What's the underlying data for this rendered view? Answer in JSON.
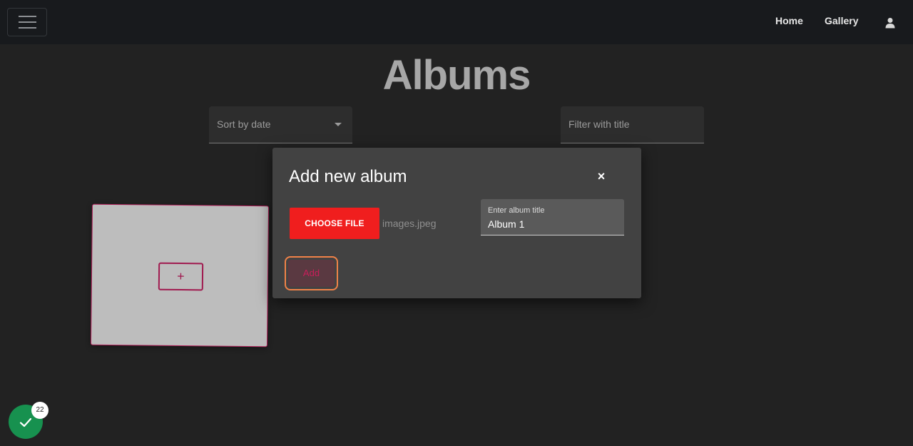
{
  "navbar": {
    "home_label": "Home",
    "gallery_label": "Gallery"
  },
  "page": {
    "title": "Albums"
  },
  "controls": {
    "sort_label": "Sort by date",
    "filter_placeholder": "Filter with title"
  },
  "album_card": {
    "add_label": "+"
  },
  "modal": {
    "title": "Add new album",
    "close_label": "×",
    "choose_file_label": "CHOOSE FILE",
    "file_name": "images.jpeg",
    "title_field_label": "Enter album title",
    "title_field_value": "Album 1",
    "submit_label": "Add"
  },
  "status_badge": {
    "count": "22",
    "color": "#17914f"
  },
  "colors": {
    "accent": "#b2205a",
    "choose_file": "#f01e1e",
    "focus_ring": "#f08248"
  }
}
